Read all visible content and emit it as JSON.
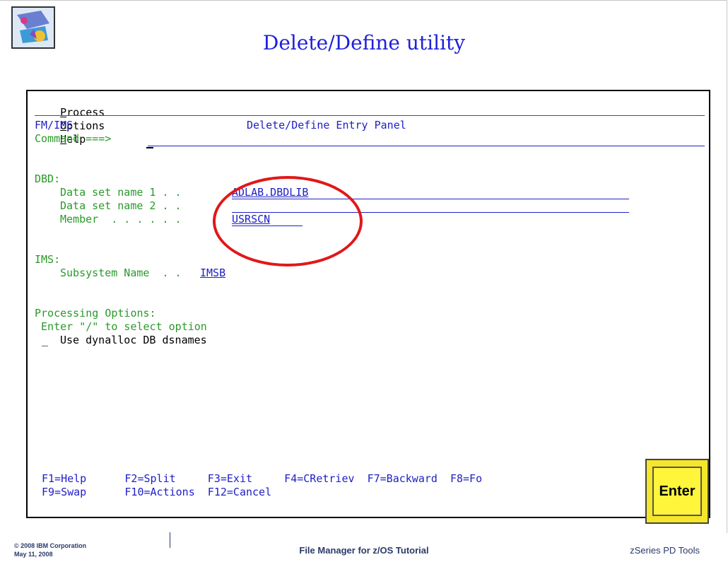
{
  "slide": {
    "title": "Delete/Define utility"
  },
  "terminal": {
    "menu": {
      "process": "rocess",
      "process_key": "P",
      "options": "ptions",
      "options_key": "O",
      "help": "elp",
      "help_key": "H"
    },
    "app_id": "FM/IMS",
    "panel_title": "Delete/Define Entry Panel",
    "command_label": "Command ===>",
    "command_value": "",
    "dbd_section": "DBD:",
    "dsn1_label": "Data set name 1 . .",
    "dsn1_value": "ADLAB.DBDLIB",
    "dsn2_label": "Data set name 2 . .",
    "dsn2_value": "",
    "member_label": "Member  . . . . . .",
    "member_value": "USRSCN",
    "ims_section": "IMS:",
    "subsys_label": "Subsystem Name  . .",
    "subsys_value": "IMSB",
    "proc_section": "Processing Options:",
    "proc_hint": " Enter \"/\" to select option",
    "opt1_mark": "_",
    "opt1_label": "Use dynalloc DB dsnames",
    "pf_row1": "F1=Help      F2=Split     F3=Exit     F4=CRetriev  F7=Backward  F8=Fo",
    "pf_row2": "F9=Swap      F10=Actions  F12=Cancel",
    "enter_label": "Enter"
  },
  "footer": {
    "copyright": "© 2008 IBM Corporation",
    "date": "May 11, 2008",
    "center": "File Manager for z/OS Tutorial",
    "right": "zSeries PD Tools"
  },
  "colors": {
    "title_blue": "#2020d8",
    "field_blue": "#2020c8",
    "label_green": "#2a9a2a",
    "highlight_red": "#e01818",
    "enter_yellow": "#f5e62a"
  }
}
